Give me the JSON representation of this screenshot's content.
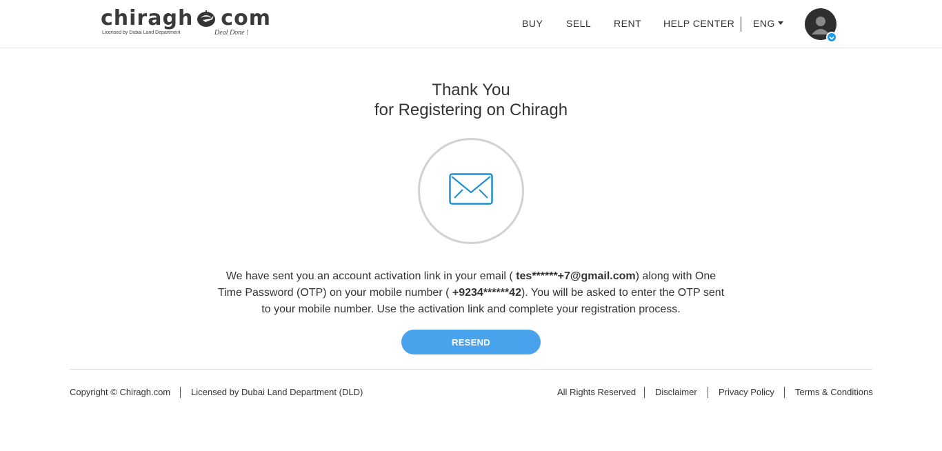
{
  "header": {
    "logo": {
      "name_left": "chiragh",
      "name_right": "com",
      "licensed": "Licensed by Dubai Land Department",
      "tagline": "Deal Done !"
    },
    "nav": [
      {
        "label": "BUY"
      },
      {
        "label": "SELL"
      },
      {
        "label": "RENT"
      },
      {
        "label": "HELP CENTER"
      }
    ],
    "language": "ENG",
    "icons": {
      "avatar": "user-avatar-icon",
      "badge": "chevron-down-icon",
      "caret": "caret-down-icon"
    }
  },
  "main": {
    "title_line1": "Thank You",
    "title_line2": "for Registering on Chiragh",
    "icon": "envelope-icon",
    "message": {
      "part1": "We have sent you an account activation link in your email ( ",
      "email": "tes******+7@gmail.com",
      "part2": ") along with One Time Password (OTP) on your mobile number ( ",
      "phone": "+9234******42",
      "part3": "). You will be asked to enter the OTP sent to your mobile number. Use the activation link and complete your registration process."
    },
    "resend_label": "RESEND"
  },
  "footer": {
    "copyright": "Copyright © Chiragh.com",
    "licensed": "Licensed by Dubai Land Department (DLD)",
    "rights": "All Rights Reserved",
    "links": [
      "Disclaimer",
      "Privacy Policy",
      "Terms & Conditions"
    ]
  },
  "colors": {
    "accent": "#49a2ec",
    "envelope": "#1e8fd0",
    "badge": "#1e9be6",
    "text": "#333333"
  }
}
